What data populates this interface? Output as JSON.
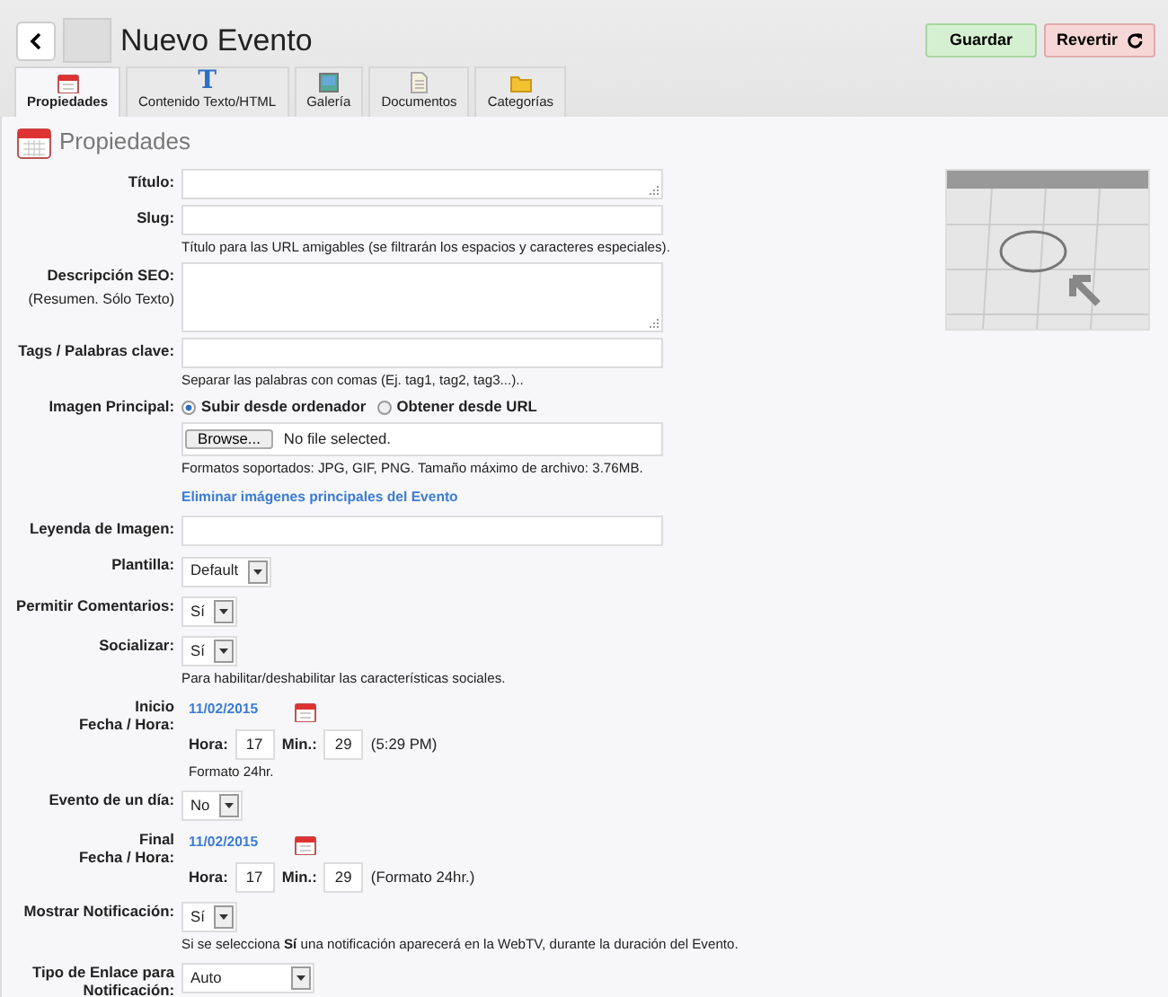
{
  "header": {
    "title": "Nuevo Evento",
    "buttons": [
      {
        "kind": "save",
        "label": "Guardar"
      },
      {
        "kind": "revert",
        "label": "Revertir"
      }
    ]
  },
  "tabs": [
    {
      "kind": "calendar",
      "label": "Propiedades",
      "selected": true
    },
    {
      "kind": "glyph",
      "glyph": "T",
      "label": "Contenido Texto/HTML",
      "selected": false
    },
    {
      "kind": "picture",
      "label": "Galería",
      "selected": false
    },
    {
      "kind": "document",
      "label": "Documentos",
      "selected": false
    },
    {
      "kind": "folder",
      "label": "Categorías",
      "selected": false
    }
  ],
  "section": {
    "title": "Propiedades"
  },
  "fields": [
    {
      "kind": "resizable",
      "label": "Título:"
    },
    {
      "kind": "text",
      "label": "Slug:",
      "help": [
        "Título para las URL amigables (se filtrarán los espacios y caracteres especiales)."
      ]
    },
    {
      "kind": "textarea",
      "label": "Descripción SEO:",
      "sublabel": "(Resumen. Sólo Texto)"
    },
    {
      "kind": "text",
      "label": "Tags / Palabras clave:",
      "help": [
        "Separar las palabras con comas (Ej. tag1, tag2, tag3...).."
      ]
    },
    {
      "kind": "image",
      "label": "Imagen Principal:",
      "options": [
        {
          "label": "Subir desde ordenador",
          "selected": true
        },
        {
          "label": "Obtener desde URL",
          "selected": false
        }
      ],
      "file_button": "Browse...",
      "file_status": "No file selected.",
      "help": [
        "Formatos soportados: JPG, GIF, PNG. Tamaño máximo de archivo: 3.76MB."
      ],
      "link": "Eliminar imágenes principales del Evento"
    },
    {
      "kind": "text",
      "label": "Leyenda de Imagen:"
    },
    {
      "kind": "select",
      "label": "Plantilla:",
      "value": "Default"
    },
    {
      "kind": "select",
      "label": "Permitir Comentarios:",
      "value": "Sí"
    },
    {
      "kind": "select",
      "label": "Socializar:",
      "value": "Sí",
      "help": [
        "Para habilitar/deshabilitar las características sociales."
      ]
    },
    {
      "kind": "datetime",
      "label": "Inicio",
      "label_2": "Fecha / Hora:",
      "date": "11/02/2015",
      "hour_label": "Hora:",
      "hour": "17",
      "min_label": "Min.:",
      "min": "29",
      "note": "(5:29 PM)",
      "help": [
        "Formato 24hr."
      ]
    },
    {
      "kind": "select",
      "label": "Evento de un día:",
      "value": "No"
    },
    {
      "kind": "datetime",
      "label": "Final",
      "label_2": "Fecha / Hora:",
      "date": "11/02/2015",
      "hour_label": "Hora:",
      "hour": "17",
      "min_label": "Min.:",
      "min": "29",
      "note": "(Formato 24hr.)"
    },
    {
      "kind": "select",
      "label": "Mostrar Notificación:",
      "value": "Sí",
      "help": [
        "Si se selecciona **Sí** una notificación aparecerá en la WebTV, durante la duración del Evento."
      ]
    },
    {
      "kind": "select",
      "label": "Tipo de Enlace para Notificación:",
      "value": "Auto",
      "wide": true
    }
  ]
}
